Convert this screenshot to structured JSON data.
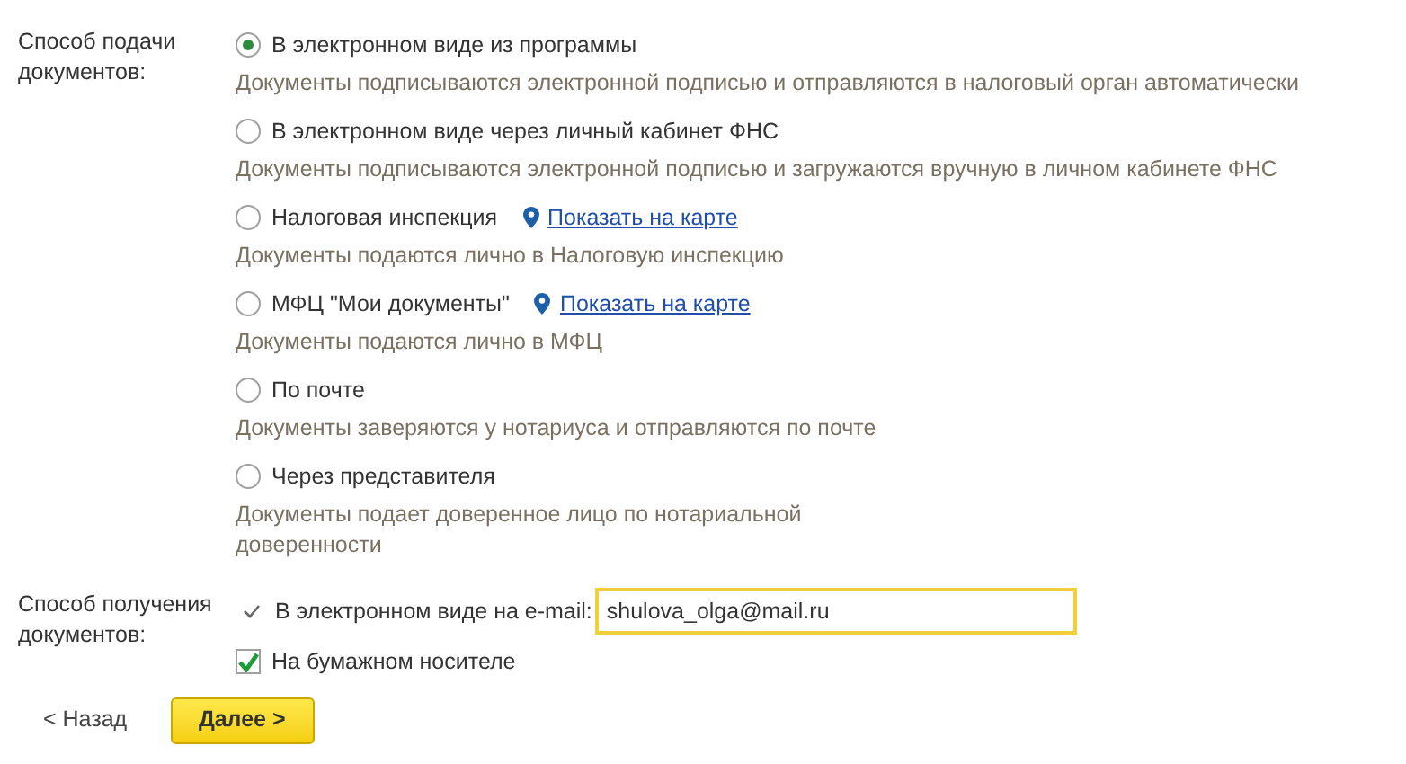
{
  "submission": {
    "label": "Способ подачи документов:",
    "options": [
      {
        "label": "В электронном виде из программы",
        "selected": true,
        "description": "Документы подписываются электронной подписью и отправляются в налоговый орган автоматически"
      },
      {
        "label": "В электронном виде через личный кабинет ФНС",
        "selected": false,
        "description": "Документы подписываются электронной подписью и загружаются вручную в личном кабинете ФНС"
      },
      {
        "label": "Налоговая инспекция",
        "selected": false,
        "link": "Показать на карте",
        "description": "Документы подаются лично в Налоговую инспекцию"
      },
      {
        "label": "МФЦ \"Мои документы\"",
        "selected": false,
        "link": "Показать на карте",
        "description": "Документы подаются лично в МФЦ"
      },
      {
        "label": "По почте",
        "selected": false,
        "description": "Документы заверяются у нотариуса и отправляются по почте"
      },
      {
        "label": "Через представителя",
        "selected": false,
        "description": "Документы подает доверенное лицо по нотариальной доверенности"
      }
    ]
  },
  "receipt": {
    "label": "Способ получения документов:",
    "options": [
      {
        "kind": "check",
        "label": "В электронном виде на e-mail:",
        "checked": true,
        "value": "shulova_olga@mail.ru"
      },
      {
        "kind": "checkbox",
        "label": "На бумажном носителе",
        "checked": true
      }
    ]
  },
  "buttons": {
    "back": "< Назад",
    "next": "Далее >"
  }
}
